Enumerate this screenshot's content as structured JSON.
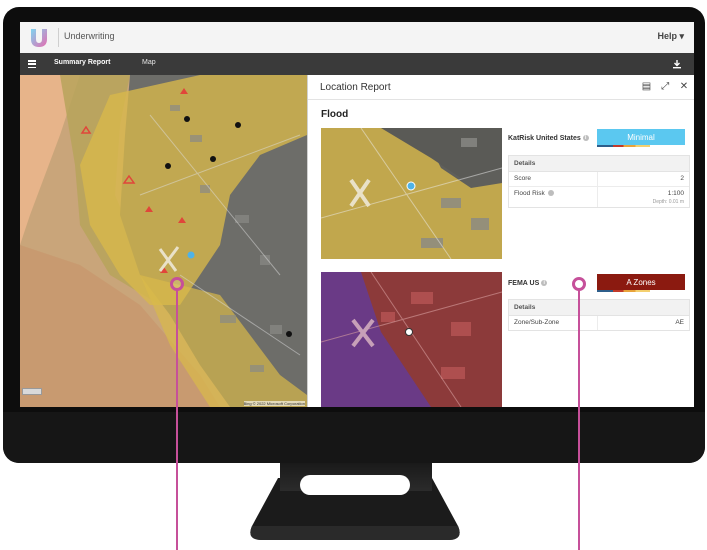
{
  "app": {
    "title": "Underwriting",
    "help_label": "Help ▾"
  },
  "nav": {
    "tabs": [
      {
        "label": "Summary Report",
        "active": true
      },
      {
        "label": "Map",
        "active": false
      }
    ]
  },
  "map": {
    "attribution": "Bing  © 2022 Microsoft Corporation"
  },
  "report": {
    "title": "Location Report",
    "section": "Flood",
    "katrisk": {
      "label": "KatRisk United States",
      "badge": "Minimal",
      "badge_color": "#5bc8f0",
      "details_header": "Details",
      "rows": [
        {
          "key": "Score",
          "value": "2",
          "sub": ""
        },
        {
          "key": "Flood Risk",
          "value": "1:100",
          "sub": "Depth: 0.01 m"
        }
      ]
    },
    "fema": {
      "label": "FEMA US",
      "badge": "A Zones",
      "badge_color": "#8b1a10",
      "details_header": "Details",
      "rows": [
        {
          "key": "Zone/Sub-Zone",
          "value": "AE"
        }
      ]
    }
  },
  "colors": {
    "callout": "#c6509a",
    "flood_overlay": "#d9b94a",
    "fema_overlay": "#b23a3a"
  }
}
